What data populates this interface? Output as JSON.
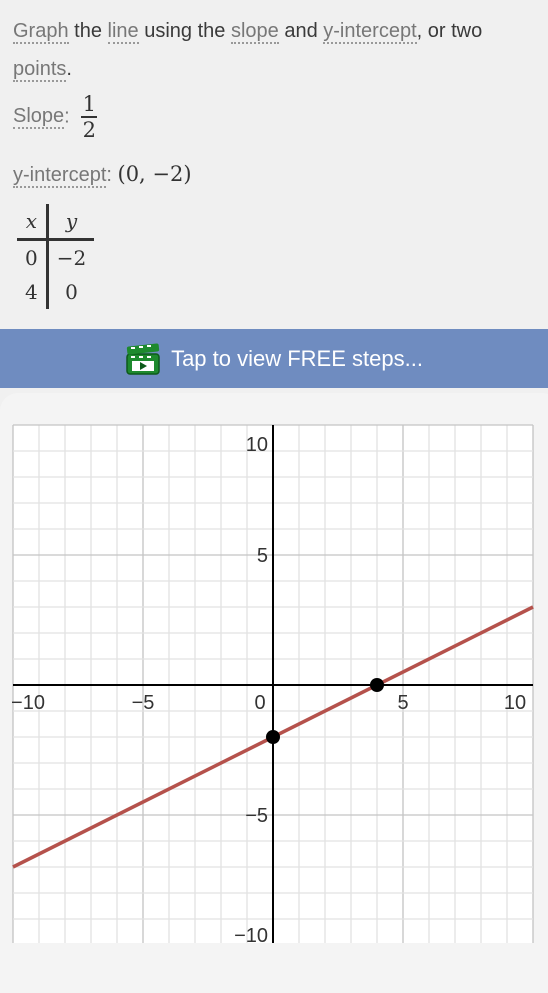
{
  "intro": {
    "parts": [
      {
        "text": "Graph",
        "term": true
      },
      {
        "text": " the ",
        "term": false
      },
      {
        "text": "line",
        "term": true
      },
      {
        "text": " using the ",
        "term": false
      },
      {
        "text": "slope",
        "term": true
      },
      {
        "text": " and ",
        "term": false
      },
      {
        "text": "y-intercept",
        "term": true
      },
      {
        "text": ", or two ",
        "term": false
      },
      {
        "text": "points",
        "term": true
      },
      {
        "text": ".",
        "term": false
      }
    ]
  },
  "slope": {
    "label": "Slope",
    "numerator": "1",
    "denominator": "2"
  },
  "intercept": {
    "label": "y-intercept",
    "value": "(0, −2)"
  },
  "table": {
    "headers": [
      "x",
      "y"
    ],
    "rows": [
      [
        "0",
        "−2"
      ],
      [
        "4",
        "0"
      ]
    ]
  },
  "banner": {
    "label": "Tap to view FREE steps...",
    "icon": "video-clapper-icon",
    "icon_color": "#1e8a2e"
  },
  "chart_data": {
    "type": "line",
    "xlim": [
      -10,
      10
    ],
    "ylim": [
      -10,
      10
    ],
    "grid": true,
    "x_ticks": [
      "-10",
      "-5",
      "0",
      "5",
      "10"
    ],
    "y_ticks": [
      "10",
      "5",
      "-5",
      "-10"
    ],
    "line": {
      "slope": 0.5,
      "intercept": -2,
      "color": "#b5524c"
    },
    "points": [
      {
        "x": 0,
        "y": -2
      },
      {
        "x": 4,
        "y": 0
      }
    ]
  }
}
